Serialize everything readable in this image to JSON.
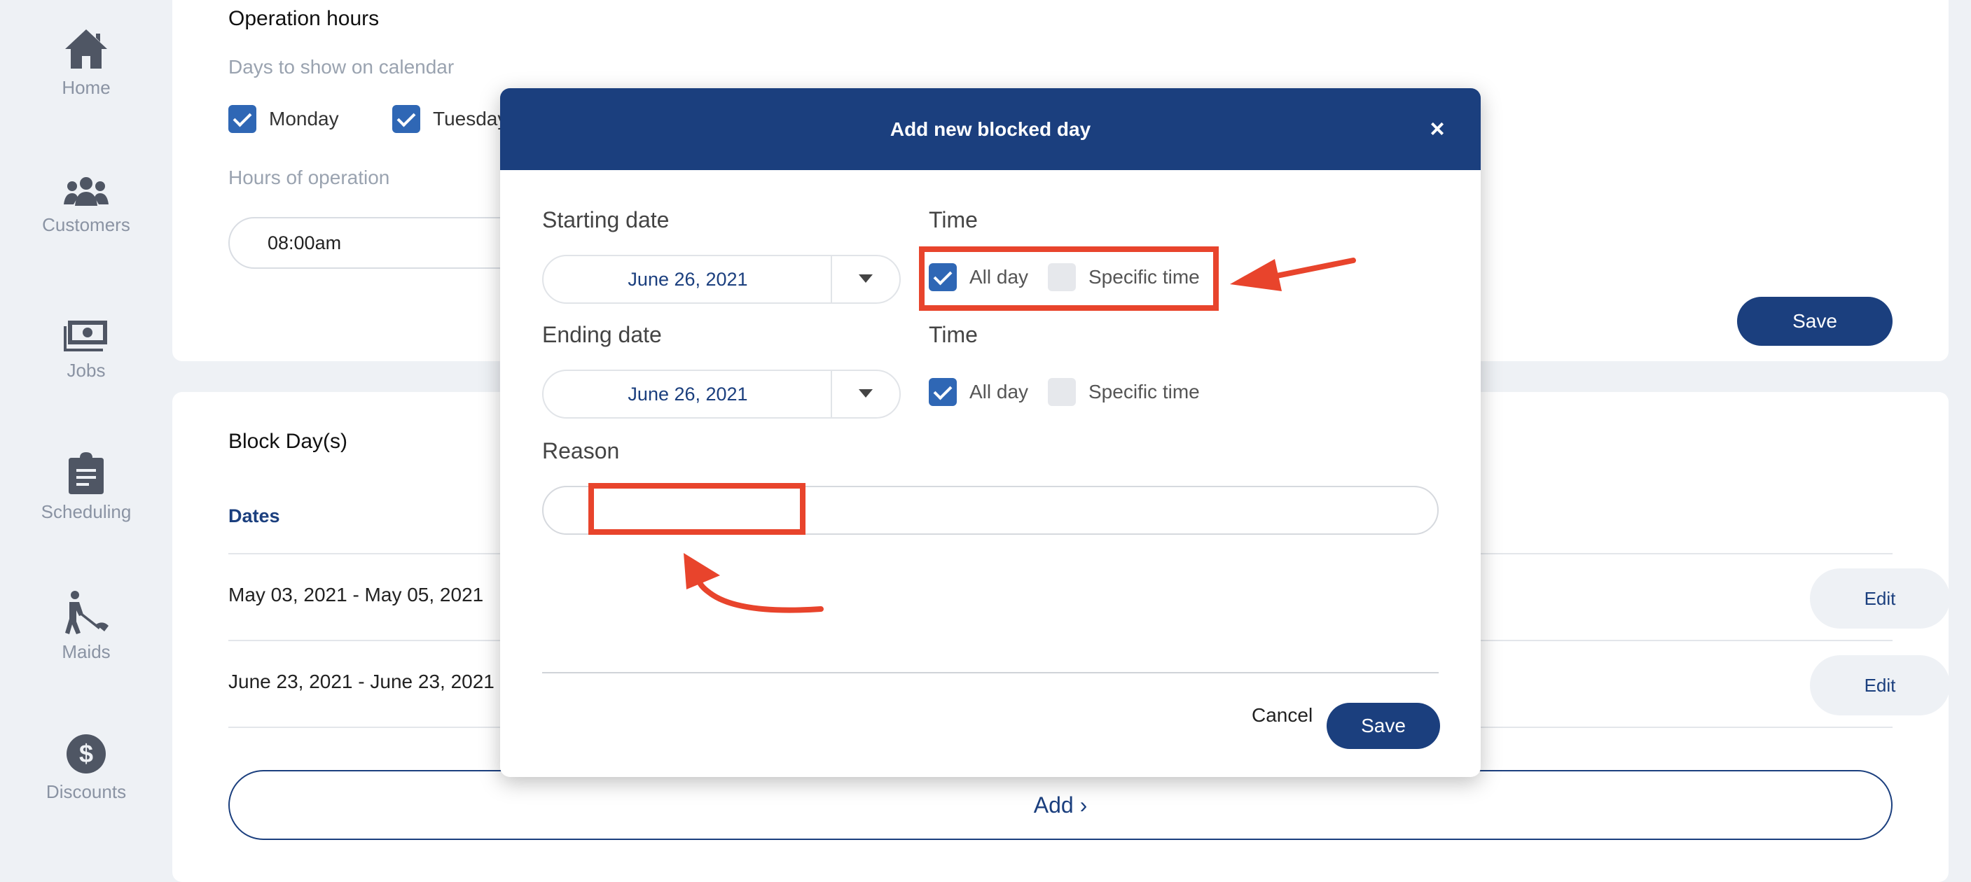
{
  "sidebar": {
    "items": [
      {
        "label": "Home",
        "icon": "home-icon"
      },
      {
        "label": "Customers",
        "icon": "users-icon"
      },
      {
        "label": "Jobs",
        "icon": "money-icon"
      },
      {
        "label": "Scheduling",
        "icon": "clipboard-icon"
      },
      {
        "label": "Maids",
        "icon": "cleaner-icon"
      },
      {
        "label": "Discounts",
        "icon": "dollar-icon"
      }
    ]
  },
  "operation_hours": {
    "title": "Operation hours",
    "days_label": "Days to show on calendar",
    "days": [
      {
        "label": "Monday",
        "checked": true
      },
      {
        "label": "Tuesday",
        "checked": true
      }
    ],
    "hours_label": "Hours of operation",
    "start_time": "08:00am",
    "save_label": "Save"
  },
  "block_days": {
    "title": "Block Day(s)",
    "column_header": "Dates",
    "rows": [
      {
        "dates": "May 03, 2021 - May 05, 2021",
        "action": "Edit"
      },
      {
        "dates": "June 23, 2021 - June 23, 2021",
        "action": "Edit"
      }
    ],
    "add_label": "Add ›"
  },
  "modal": {
    "title": "Add new blocked day",
    "close": "×",
    "starting_date_label": "Starting date",
    "starting_date_value": "June 26, 2021",
    "ending_date_label": "Ending date",
    "ending_date_value": "June 26, 2021",
    "time_label": "Time",
    "all_day_label": "All day",
    "specific_time_label": "Specific time",
    "start_all_day": true,
    "end_all_day": true,
    "reason_label": "Reason",
    "reason_value": "",
    "cancel_label": "Cancel",
    "save_label": "Save"
  },
  "colors": {
    "primary": "#1b3f7e",
    "checkbox": "#2f67b5",
    "annotation": "#e8442c"
  }
}
